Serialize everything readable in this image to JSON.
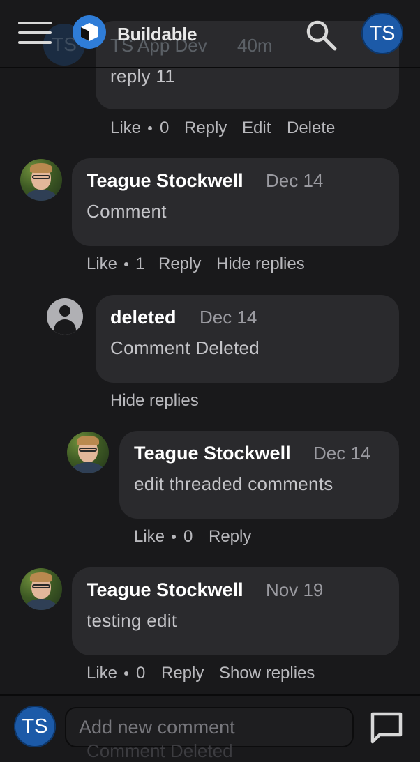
{
  "header": {
    "app_name": "Buildable",
    "user_initials": "TS",
    "icons": [
      "menu-icon",
      "logo-icon",
      "search-icon"
    ]
  },
  "partial_comment": {
    "author_initials": "TS",
    "author": "TS App Dev",
    "time": "40m",
    "text": "reply 11",
    "like_label": "Like",
    "like_count": "0",
    "reply_label": "Reply",
    "edit_label": "Edit",
    "delete_label": "Delete"
  },
  "comment1": {
    "author": "Teague Stockwell",
    "date": "Dec 14",
    "text": "Comment",
    "like_label": "Like",
    "like_count": "1",
    "reply_label": "Reply",
    "toggle_label": "Hide replies"
  },
  "comment2": {
    "author": "deleted",
    "date": "Dec 14",
    "text": "Comment Deleted",
    "toggle_label": "Hide replies"
  },
  "comment3": {
    "author": "Teague Stockwell",
    "date": "Dec 14",
    "text": "edit threaded comments",
    "like_label": "Like",
    "like_count": "0",
    "reply_label": "Reply"
  },
  "comment4": {
    "author": "Teague Stockwell",
    "date": "Nov 19",
    "text": "testing edit",
    "like_label": "Like",
    "like_count": "0",
    "reply_label": "Reply",
    "toggle_label": "Show replies"
  },
  "footer": {
    "user_initials": "TS",
    "placeholder": "Add new comment",
    "behind_text": "Comment Deleted",
    "icons": [
      "comment-send-icon"
    ]
  },
  "colors": {
    "background": "#19191b",
    "bubble": "#2a2a2d",
    "accent": "#1c5aa8"
  }
}
